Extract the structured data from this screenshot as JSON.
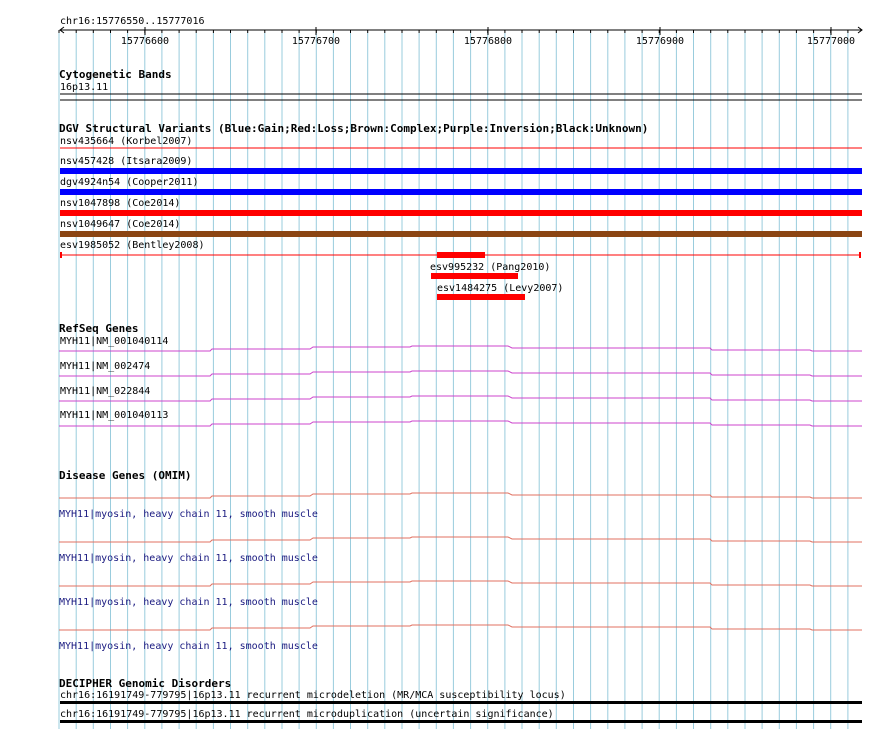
{
  "region": {
    "label": "chr16:15776550..15777016",
    "start": 15776550,
    "end": 15777016
  },
  "ruler": {
    "ticks": [
      "15776600",
      "15776700",
      "15776800",
      "15776900",
      "15777000"
    ]
  },
  "colors": {
    "grid": "#99ccdd",
    "gain": "#0000ff",
    "loss": "#ff0000",
    "complex": "#8b4513",
    "refseq": "#cc44cc",
    "omim": "#e07060",
    "omim_text": "#1a1a80"
  },
  "cytobands": {
    "title": "Cytogenetic Bands",
    "band": "16p13.11"
  },
  "dgv": {
    "title": "DGV Structural Variants (Blue:Gain;Red:Loss;Brown:Complex;Purple:Inversion;Black:Unknown)",
    "variants": [
      {
        "label": "nsv435664 (Korbel2007)",
        "type": "loss",
        "style": "thin"
      },
      {
        "label": "nsv457428 (Itsara2009)",
        "type": "gain",
        "style": "thick"
      },
      {
        "label": "dgv4924n54 (Cooper2011)",
        "type": "gain",
        "style": "thick"
      },
      {
        "label": "nsv1047898 (Coe2014)",
        "type": "loss",
        "style": "thick"
      },
      {
        "label": "nsv1049647 (Coe2014)",
        "type": "complex",
        "style": "thick"
      },
      {
        "label": "esv1985052 (Bentley2008)",
        "type": "loss",
        "style": "thin-ticks"
      },
      {
        "label": "esv995232 (Pang2010)",
        "type": "loss",
        "style": "short"
      },
      {
        "label": "esv1484275 (Levy2007)",
        "type": "loss",
        "style": "short"
      }
    ]
  },
  "refseq": {
    "title": "RefSeq Genes",
    "genes": [
      "MYH11|NM_001040114",
      "MYH11|NM_002474",
      "MYH11|NM_022844",
      "MYH11|NM_001040113"
    ]
  },
  "omim": {
    "title": "Disease Genes (OMIM)",
    "genes": [
      "MYH11|myosin, heavy chain 11, smooth muscle",
      "MYH11|myosin, heavy chain 11, smooth muscle",
      "MYH11|myosin, heavy chain 11, smooth muscle",
      "MYH11|myosin, heavy chain 11, smooth muscle"
    ]
  },
  "decipher": {
    "title": "DECIPHER Genomic Disorders",
    "entries": [
      "chr16:16191749-779795|16p13.11 recurrent microdeletion (MR/MCA susceptibility locus)",
      "chr16:16191749-779795|16p13.11 recurrent microduplication (uncertain significance)"
    ]
  }
}
